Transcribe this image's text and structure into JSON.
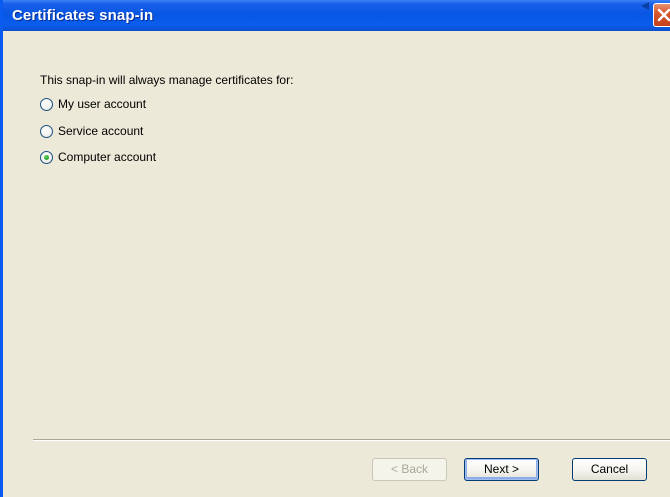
{
  "window": {
    "title": "Certificates snap-in"
  },
  "dialog": {
    "prompt": "This snap-in will always manage certificates for:",
    "options": [
      {
        "label": "My user account",
        "selected": false
      },
      {
        "label": "Service account",
        "selected": false
      },
      {
        "label": "Computer account",
        "selected": true
      }
    ]
  },
  "buttons": {
    "back": "< Back",
    "next": "Next >",
    "cancel": "Cancel"
  },
  "colors": {
    "titlebar": "#0856E4",
    "dialog_bg": "#ECE9D8",
    "close_button": "#D9582D",
    "radio_dot": "#21A121"
  }
}
